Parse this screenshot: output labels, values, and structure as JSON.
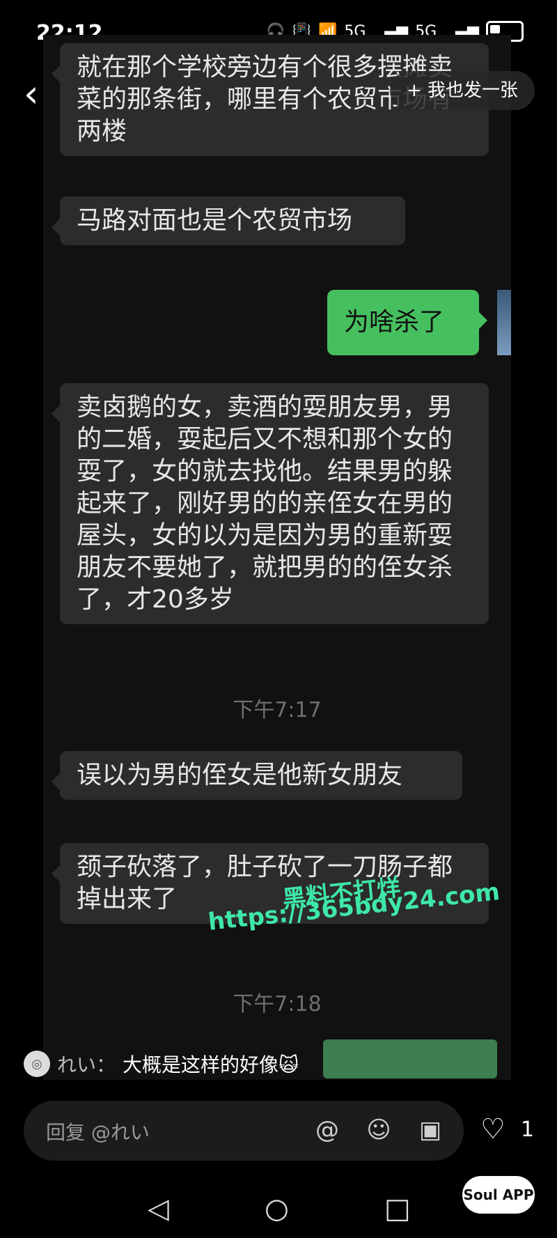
{
  "status_bar": {
    "time": "22:12",
    "signal1": "5G",
    "signal2": "5G"
  },
  "header": {
    "post_button_label": "+ 我也发一张"
  },
  "messages": [
    {
      "side": "left",
      "text": "就在那个学校旁边有个很多摆摊卖菜的那条街，哪里有个农贸市场有两楼"
    },
    {
      "side": "left",
      "text": "马路对面也是个农贸市场"
    },
    {
      "side": "right",
      "text": "为啥杀了"
    },
    {
      "side": "left",
      "text": "卖卤鹅的女，卖酒的耍朋友男，男的二婚，耍起后又不想和那个女的耍了，女的就去找他。结果男的躲起来了，刚好男的的亲侄女在男的屋头，女的以为是因为男的重新耍朋友不要她了，就把男的的侄女杀了，才20多岁"
    },
    {
      "side": "left",
      "text": "误以为男的侄女是他新女朋友"
    },
    {
      "side": "left",
      "text": "颈子砍落了，肚子砍了一刀肠子都掉出来了"
    }
  ],
  "timestamps": [
    "下午7:17",
    "下午7:18"
  ],
  "watermark": {
    "line1": "黑料不打烊",
    "line2": "https://365bdy24.com"
  },
  "comment": {
    "author": "れい：",
    "text": "大概是这样的好像🙀"
  },
  "reply": {
    "placeholder": "回复 @れい"
  },
  "likes": {
    "count": "1"
  },
  "brand": {
    "label": "Soul APP"
  },
  "colors": {
    "green_bubble": "#46c05f",
    "dark_bubble": "#2c2c2c",
    "watermark": "#3ee8a8"
  }
}
